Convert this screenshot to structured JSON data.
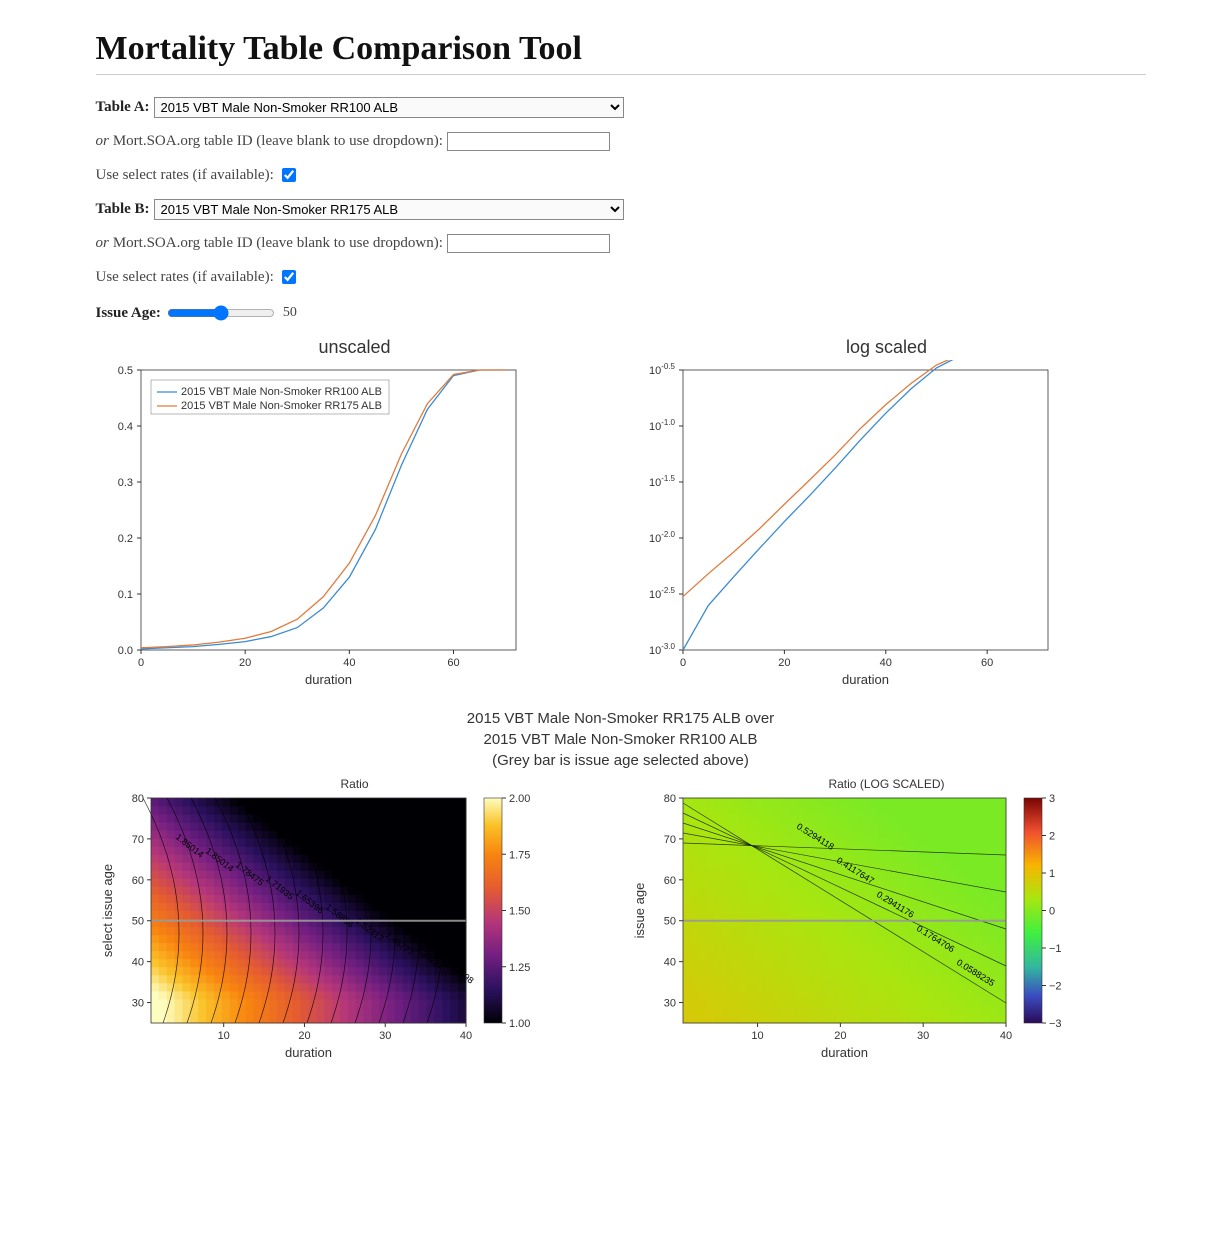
{
  "title": "Mortality Table Comparison Tool",
  "tableA": {
    "label": "Table A:",
    "selected": "2015 VBT Male Non-Smoker RR100 ALB",
    "or_label": "or",
    "id_label": " Mort.SOA.org table ID (leave blank to use dropdown): ",
    "id_value": "",
    "select_label": "Use select rates (if available): ",
    "select_checked": true
  },
  "tableB": {
    "label": "Table B:",
    "selected": "2015 VBT Male Non-Smoker RR175 ALB",
    "or_label": "or",
    "id_label": " Mort.SOA.org table ID (leave blank to use dropdown): ",
    "id_value": "",
    "select_label": "Use select rates (if available): ",
    "select_checked": true
  },
  "issue_age": {
    "label": "Issue Age:",
    "value": 50,
    "min": 18,
    "max": 95
  },
  "top_charts": {
    "left_title": "unscaled",
    "right_title": "log scaled",
    "xlabel": "duration"
  },
  "legend": {
    "a": "2015 VBT Male Non-Smoker RR100 ALB",
    "b": "2015 VBT Male Non-Smoker RR175 ALB"
  },
  "mid_title_line1": "2015 VBT Male Non-Smoker RR175 ALB over",
  "mid_title_line2": "2015 VBT Male Non-Smoker RR100 ALB",
  "mid_title_line3": "(Grey bar is issue age selected above)",
  "bot_charts": {
    "left_title": "Ratio",
    "right_title": "Ratio (LOG SCALED)",
    "xlabel": "duration",
    "ylabel_left": "select issue age",
    "ylabel_right": "issue age"
  },
  "chart_data": [
    {
      "type": "line",
      "title": "unscaled",
      "xlabel": "duration",
      "ylabel": "",
      "xlim": [
        0,
        72
      ],
      "ylim": [
        0,
        0.5
      ],
      "xticks": [
        0,
        20,
        40,
        60
      ],
      "yticks": [
        0.0,
        0.1,
        0.2,
        0.3,
        0.4,
        0.5
      ],
      "x": [
        0,
        5,
        10,
        15,
        20,
        25,
        30,
        35,
        40,
        45,
        50,
        55,
        60,
        65,
        70
      ],
      "series": [
        {
          "name": "2015 VBT Male Non-Smoker RR100 ALB",
          "color": "#3b8bd4",
          "values": [
            0.002,
            0.004,
            0.006,
            0.01,
            0.015,
            0.024,
            0.04,
            0.075,
            0.13,
            0.215,
            0.33,
            0.43,
            0.49,
            0.5,
            0.5
          ]
        },
        {
          "name": "2015 VBT Male Non-Smoker RR175 ALB",
          "color": "#e07b3e",
          "values": [
            0.004,
            0.006,
            0.009,
            0.014,
            0.021,
            0.033,
            0.055,
            0.095,
            0.155,
            0.24,
            0.35,
            0.44,
            0.492,
            0.5,
            0.5
          ]
        }
      ],
      "legend_pos": "upper-left"
    },
    {
      "type": "line",
      "title": "log scaled",
      "xlabel": "duration",
      "ylabel": "",
      "xlim": [
        0,
        72
      ],
      "yscale": "log",
      "ytick_labels": [
        "10^-3.0",
        "10^-2.5",
        "10^-2.0",
        "10^-1.5",
        "10^-1.0",
        "10^-0.5"
      ],
      "ytick_vals": [
        0.001,
        0.00316,
        0.01,
        0.0316,
        0.1,
        0.316
      ],
      "xticks": [
        0,
        20,
        40,
        60
      ],
      "x": [
        0,
        5,
        10,
        15,
        20,
        25,
        30,
        35,
        40,
        45,
        50,
        55,
        60,
        65,
        70
      ],
      "series": [
        {
          "name": "2015 VBT Male Non-Smoker RR100 ALB",
          "color": "#3b8bd4",
          "values": [
            0.001,
            0.0025,
            0.0045,
            0.008,
            0.014,
            0.024,
            0.042,
            0.075,
            0.13,
            0.215,
            0.33,
            0.43,
            0.49,
            0.5,
            0.5
          ]
        },
        {
          "name": "2015 VBT Male Non-Smoker RR175 ALB",
          "color": "#e07b3e",
          "values": [
            0.003,
            0.0048,
            0.0075,
            0.012,
            0.02,
            0.033,
            0.055,
            0.095,
            0.155,
            0.24,
            0.35,
            0.44,
            0.492,
            0.5,
            0.5
          ]
        }
      ]
    },
    {
      "type": "heatmap",
      "title": "Ratio",
      "xlabel": "duration",
      "ylabel": "select issue age",
      "xlim": [
        1,
        40
      ],
      "ylim": [
        25,
        80
      ],
      "xticks": [
        10,
        20,
        30,
        40
      ],
      "yticks": [
        30,
        40,
        50,
        60,
        70,
        80
      ],
      "colorbar": {
        "min": 1.0,
        "max": 2.0,
        "ticks": [
          1.0,
          1.25,
          1.5,
          1.75,
          2.0
        ],
        "cmap": "magma"
      },
      "contour_labels": [
        1.85014,
        1.85014,
        1.78475,
        1.71935,
        1.65396,
        1.58856,
        1.52317,
        1.45777,
        1.39237,
        1.32698,
        1.26158,
        1.19619
      ],
      "issue_age_line": 50
    },
    {
      "type": "heatmap",
      "title": "Ratio (LOG SCALED)",
      "xlabel": "duration",
      "ylabel": "issue age",
      "xlim": [
        1,
        40
      ],
      "ylim": [
        25,
        80
      ],
      "xticks": [
        10,
        20,
        30,
        40
      ],
      "yticks": [
        30,
        40,
        50,
        60,
        70,
        80
      ],
      "colorbar": {
        "min": -3,
        "max": 3,
        "ticks": [
          -3,
          -2,
          -1,
          0,
          1,
          2,
          3
        ],
        "cmap": "rainbow"
      },
      "contour_labels": [
        0.5294118,
        0.4117647,
        0.2941176,
        0.1764706,
        0.0588235
      ],
      "issue_age_line": 50
    }
  ]
}
